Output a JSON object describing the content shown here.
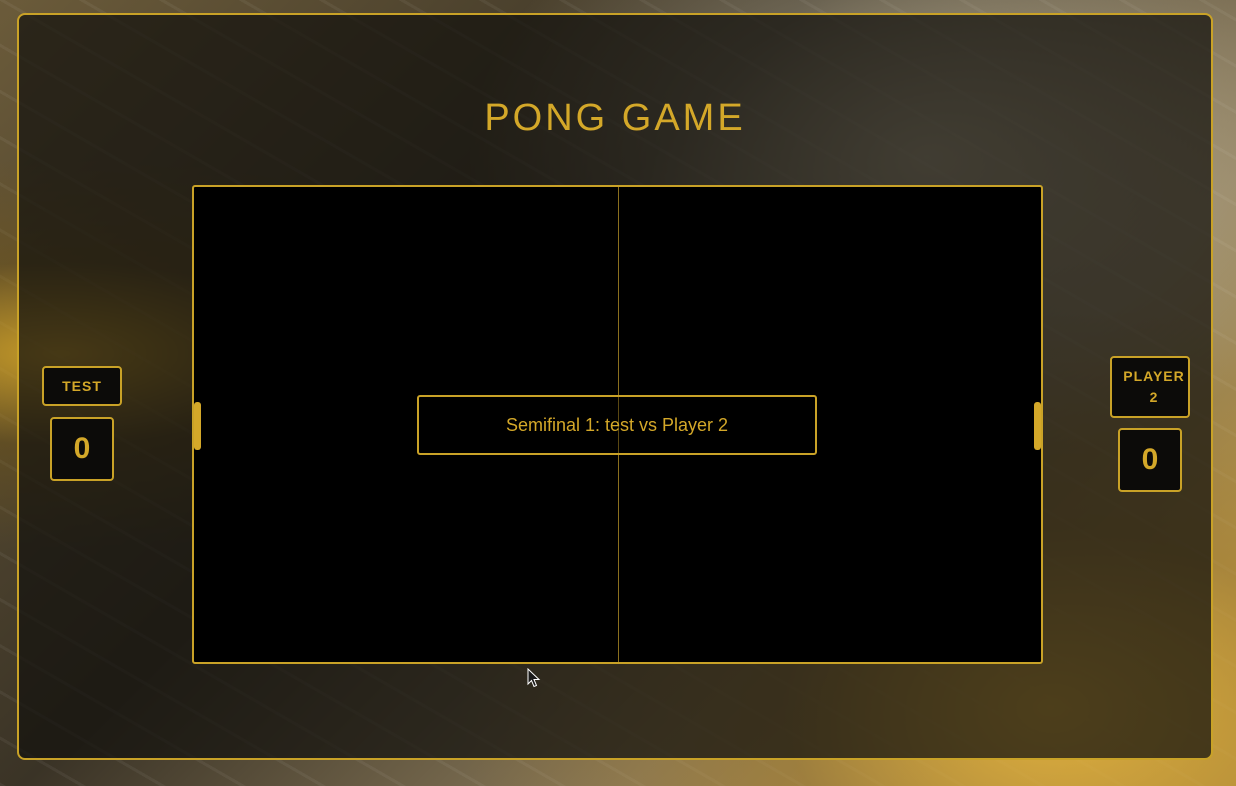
{
  "title": "PONG GAME",
  "match": {
    "announcement": "Semifinal 1: test vs Player 2"
  },
  "players": {
    "left": {
      "name": "TEST",
      "score": "0"
    },
    "right": {
      "name_line1": "PLAYER",
      "name_line2": "2",
      "score": "0"
    }
  },
  "colors": {
    "accent": "#d4a829",
    "court": "#000000"
  }
}
